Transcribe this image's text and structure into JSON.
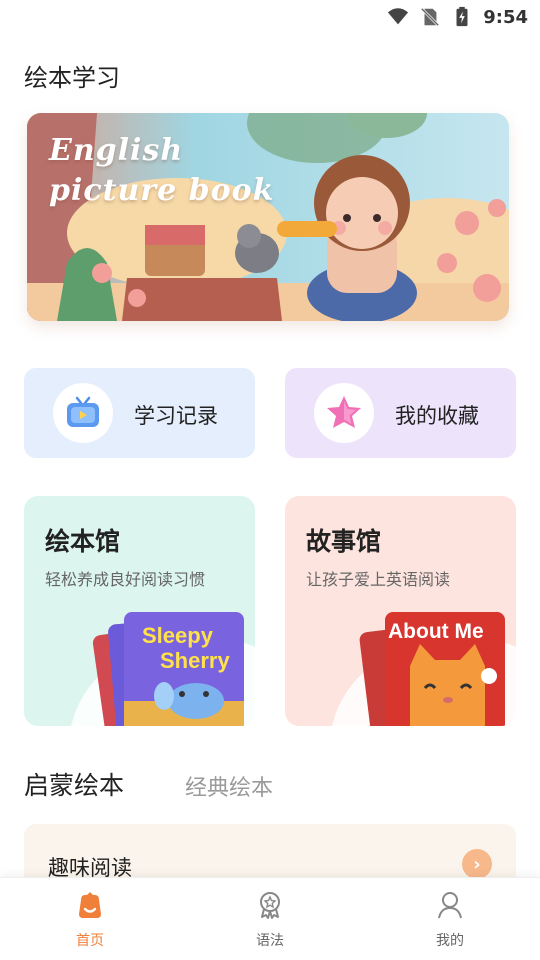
{
  "status_bar": {
    "time": "9:54",
    "icons": [
      "wifi-icon",
      "no-sim-icon",
      "battery-charging-icon"
    ]
  },
  "page": {
    "title": "绘本学习"
  },
  "banner": {
    "line1": "English",
    "line2": "picture book"
  },
  "quick_actions": [
    {
      "label": "学习记录",
      "icon": "tv-icon"
    },
    {
      "label": "我的收藏",
      "icon": "star-icon"
    }
  ],
  "libraries": [
    {
      "title": "绘本馆",
      "subtitle": "轻松养成良好阅读习惯",
      "book_title_line1": "Sleepy",
      "book_title_line2": "Sherry"
    },
    {
      "title": "故事馆",
      "subtitle": "让孩子爱上英语阅读",
      "book_title": "About Me"
    }
  ],
  "tabs": {
    "active": "启蒙绘本",
    "inactive": "经典绘本"
  },
  "list": {
    "first_item": "趣味阅读"
  },
  "bottom_nav": [
    {
      "label": "首页",
      "icon": "home-icon",
      "active": true
    },
    {
      "label": "语法",
      "icon": "badge-icon",
      "active": false
    },
    {
      "label": "我的",
      "icon": "profile-icon",
      "active": false
    }
  ],
  "colors": {
    "accent": "#f07f3a",
    "study_card": "#e4eefc",
    "fav_card": "#ede3fb",
    "picture_card": "#dcf6ef",
    "story_card": "#fde4df"
  }
}
